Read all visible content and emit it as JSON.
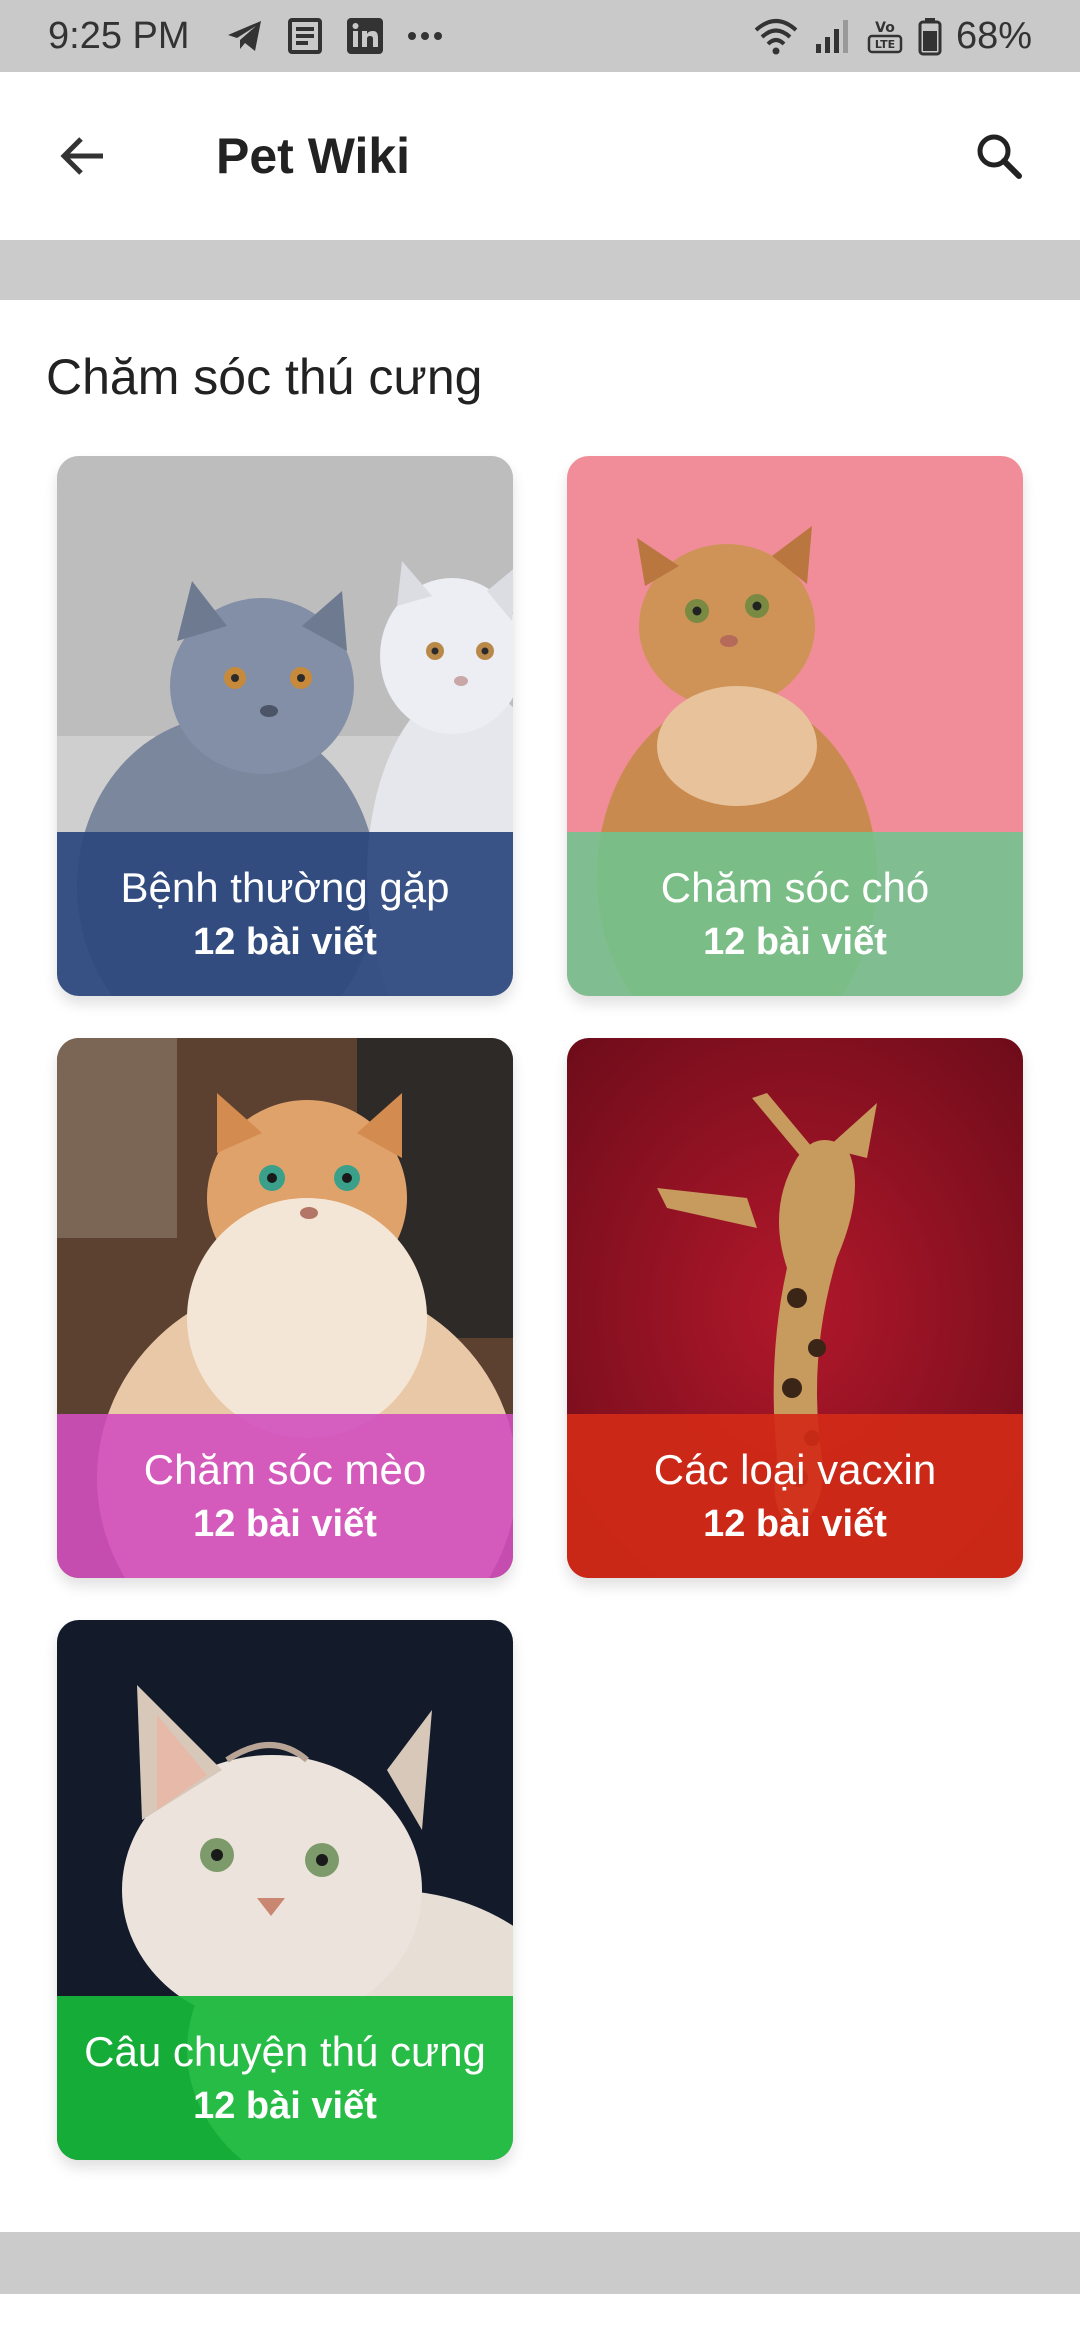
{
  "status_bar": {
    "time": "9:25 PM",
    "battery": "68%",
    "icons_left": [
      "telegram-icon",
      "news-icon",
      "linkedin-icon",
      "more-dots-icon"
    ],
    "icons_right": [
      "wifi-icon",
      "signal-icon",
      "volte-icon",
      "battery-icon"
    ]
  },
  "app_bar": {
    "title": "Pet Wiki"
  },
  "section": {
    "title": "Chăm sóc thú cưng"
  },
  "cards": [
    {
      "title": "Bệnh thường gặp",
      "count": "12 bài viết",
      "overlay_color": "#2c477e"
    },
    {
      "title": "Chăm sóc chó",
      "count": "12 bài viết",
      "overlay_color": "#6fc48f"
    },
    {
      "title": "Chăm sóc mèo",
      "count": "12 bài viết",
      "overlay_color": "#d24fbf"
    },
    {
      "title": "Các loại vacxin",
      "count": "12 bài viết",
      "overlay_color": "#d12a17"
    },
    {
      "title": "Câu chuyện thú cưng",
      "count": "12 bài viết",
      "overlay_color": "#17b83a"
    }
  ]
}
